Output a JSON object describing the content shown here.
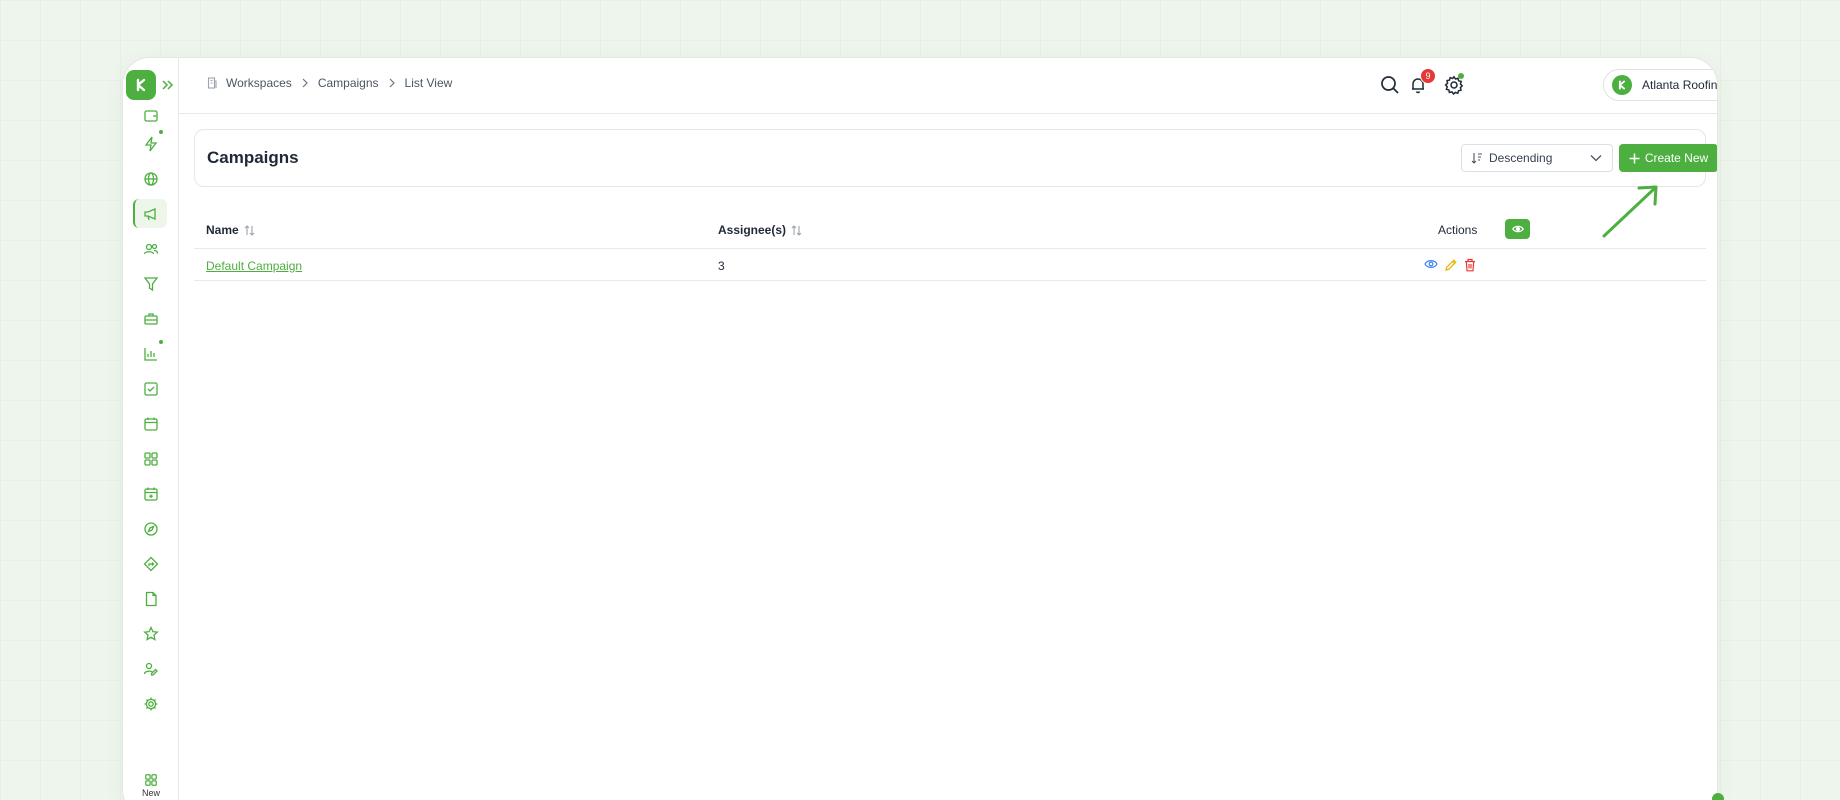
{
  "breadcrumb": {
    "items": [
      "Workspaces",
      "Campaigns",
      "List View"
    ]
  },
  "notifications": {
    "count": "9"
  },
  "workspace": {
    "name": "Atlanta Roofing"
  },
  "page": {
    "title": "Campaigns"
  },
  "sort": {
    "selected": "Descending"
  },
  "toolbar": {
    "create_label": "Create New"
  },
  "table": {
    "columns": {
      "name": "Name",
      "assignees": "Assignee(s)",
      "actions": "Actions"
    },
    "rows": [
      {
        "name": "Default Campaign",
        "assignees": "3"
      }
    ]
  },
  "sidebar": {
    "new_label": "New"
  },
  "colors": {
    "accent": "#4caf3f",
    "danger": "#e53935",
    "view_icon": "#3b82f6",
    "edit_icon": "#eab308"
  },
  "icons": {
    "sidebar": [
      "wallet-icon",
      "lightning-icon",
      "globe-icon",
      "megaphone-icon",
      "users-icon",
      "funnel-icon",
      "briefcase-icon",
      "bar-chart-icon",
      "checkbox-icon",
      "calendar-icon",
      "grid-icon",
      "calendar-plus-icon",
      "compass-icon",
      "diamond-arrow-icon",
      "document-icon",
      "star-icon",
      "user-edit-icon",
      "gear-icon"
    ]
  }
}
